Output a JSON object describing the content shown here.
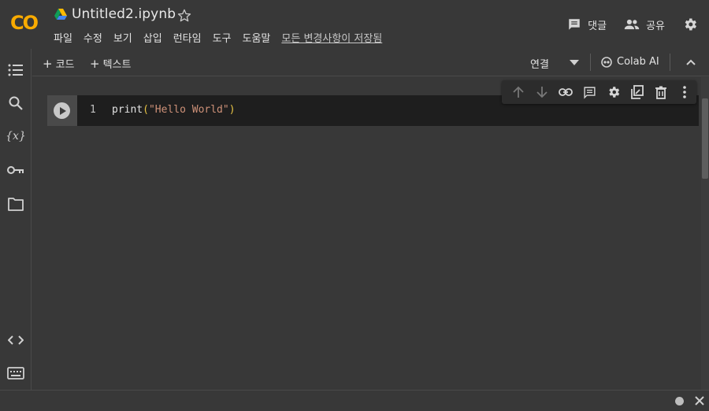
{
  "header": {
    "logo": "CO",
    "title": "Untitled2.ipynb",
    "menu": [
      "파일",
      "수정",
      "보기",
      "삽입",
      "런타임",
      "도구",
      "도움말"
    ],
    "saved_status": "모든 변경사항이 저장됨",
    "comment_label": "댓글",
    "share_label": "공유"
  },
  "toolbar": {
    "add_code_label": "코드",
    "add_text_label": "텍스트",
    "connect_label": "연결",
    "colab_ai_label": "Colab AI"
  },
  "rail": {
    "variables_label": "{x}"
  },
  "cell": {
    "line_number": "1",
    "code_fn": "print",
    "code_open": "(",
    "code_string": "\"Hello World\"",
    "code_close": ")"
  },
  "colors": {
    "background": "#383838",
    "cell_bg": "#1e1e1e",
    "logo_orange": "#f9ab00",
    "string_color": "#ce9178",
    "paren_color": "#e6c345"
  },
  "icons": {
    "header": [
      "drive-icon",
      "star-icon",
      "comment-icon",
      "share-people-icon",
      "settings-gear-icon"
    ],
    "rail": [
      "toc-icon",
      "search-icon",
      "variables-icon",
      "key-icon",
      "folder-icon",
      "code-snippets-icon",
      "terminal-icon"
    ],
    "cell_toolbar": [
      "arrow-up-icon",
      "arrow-down-icon",
      "link-icon",
      "comment-icon",
      "gear-icon",
      "mirror-cell-icon",
      "trash-icon",
      "more-vert-icon"
    ]
  }
}
